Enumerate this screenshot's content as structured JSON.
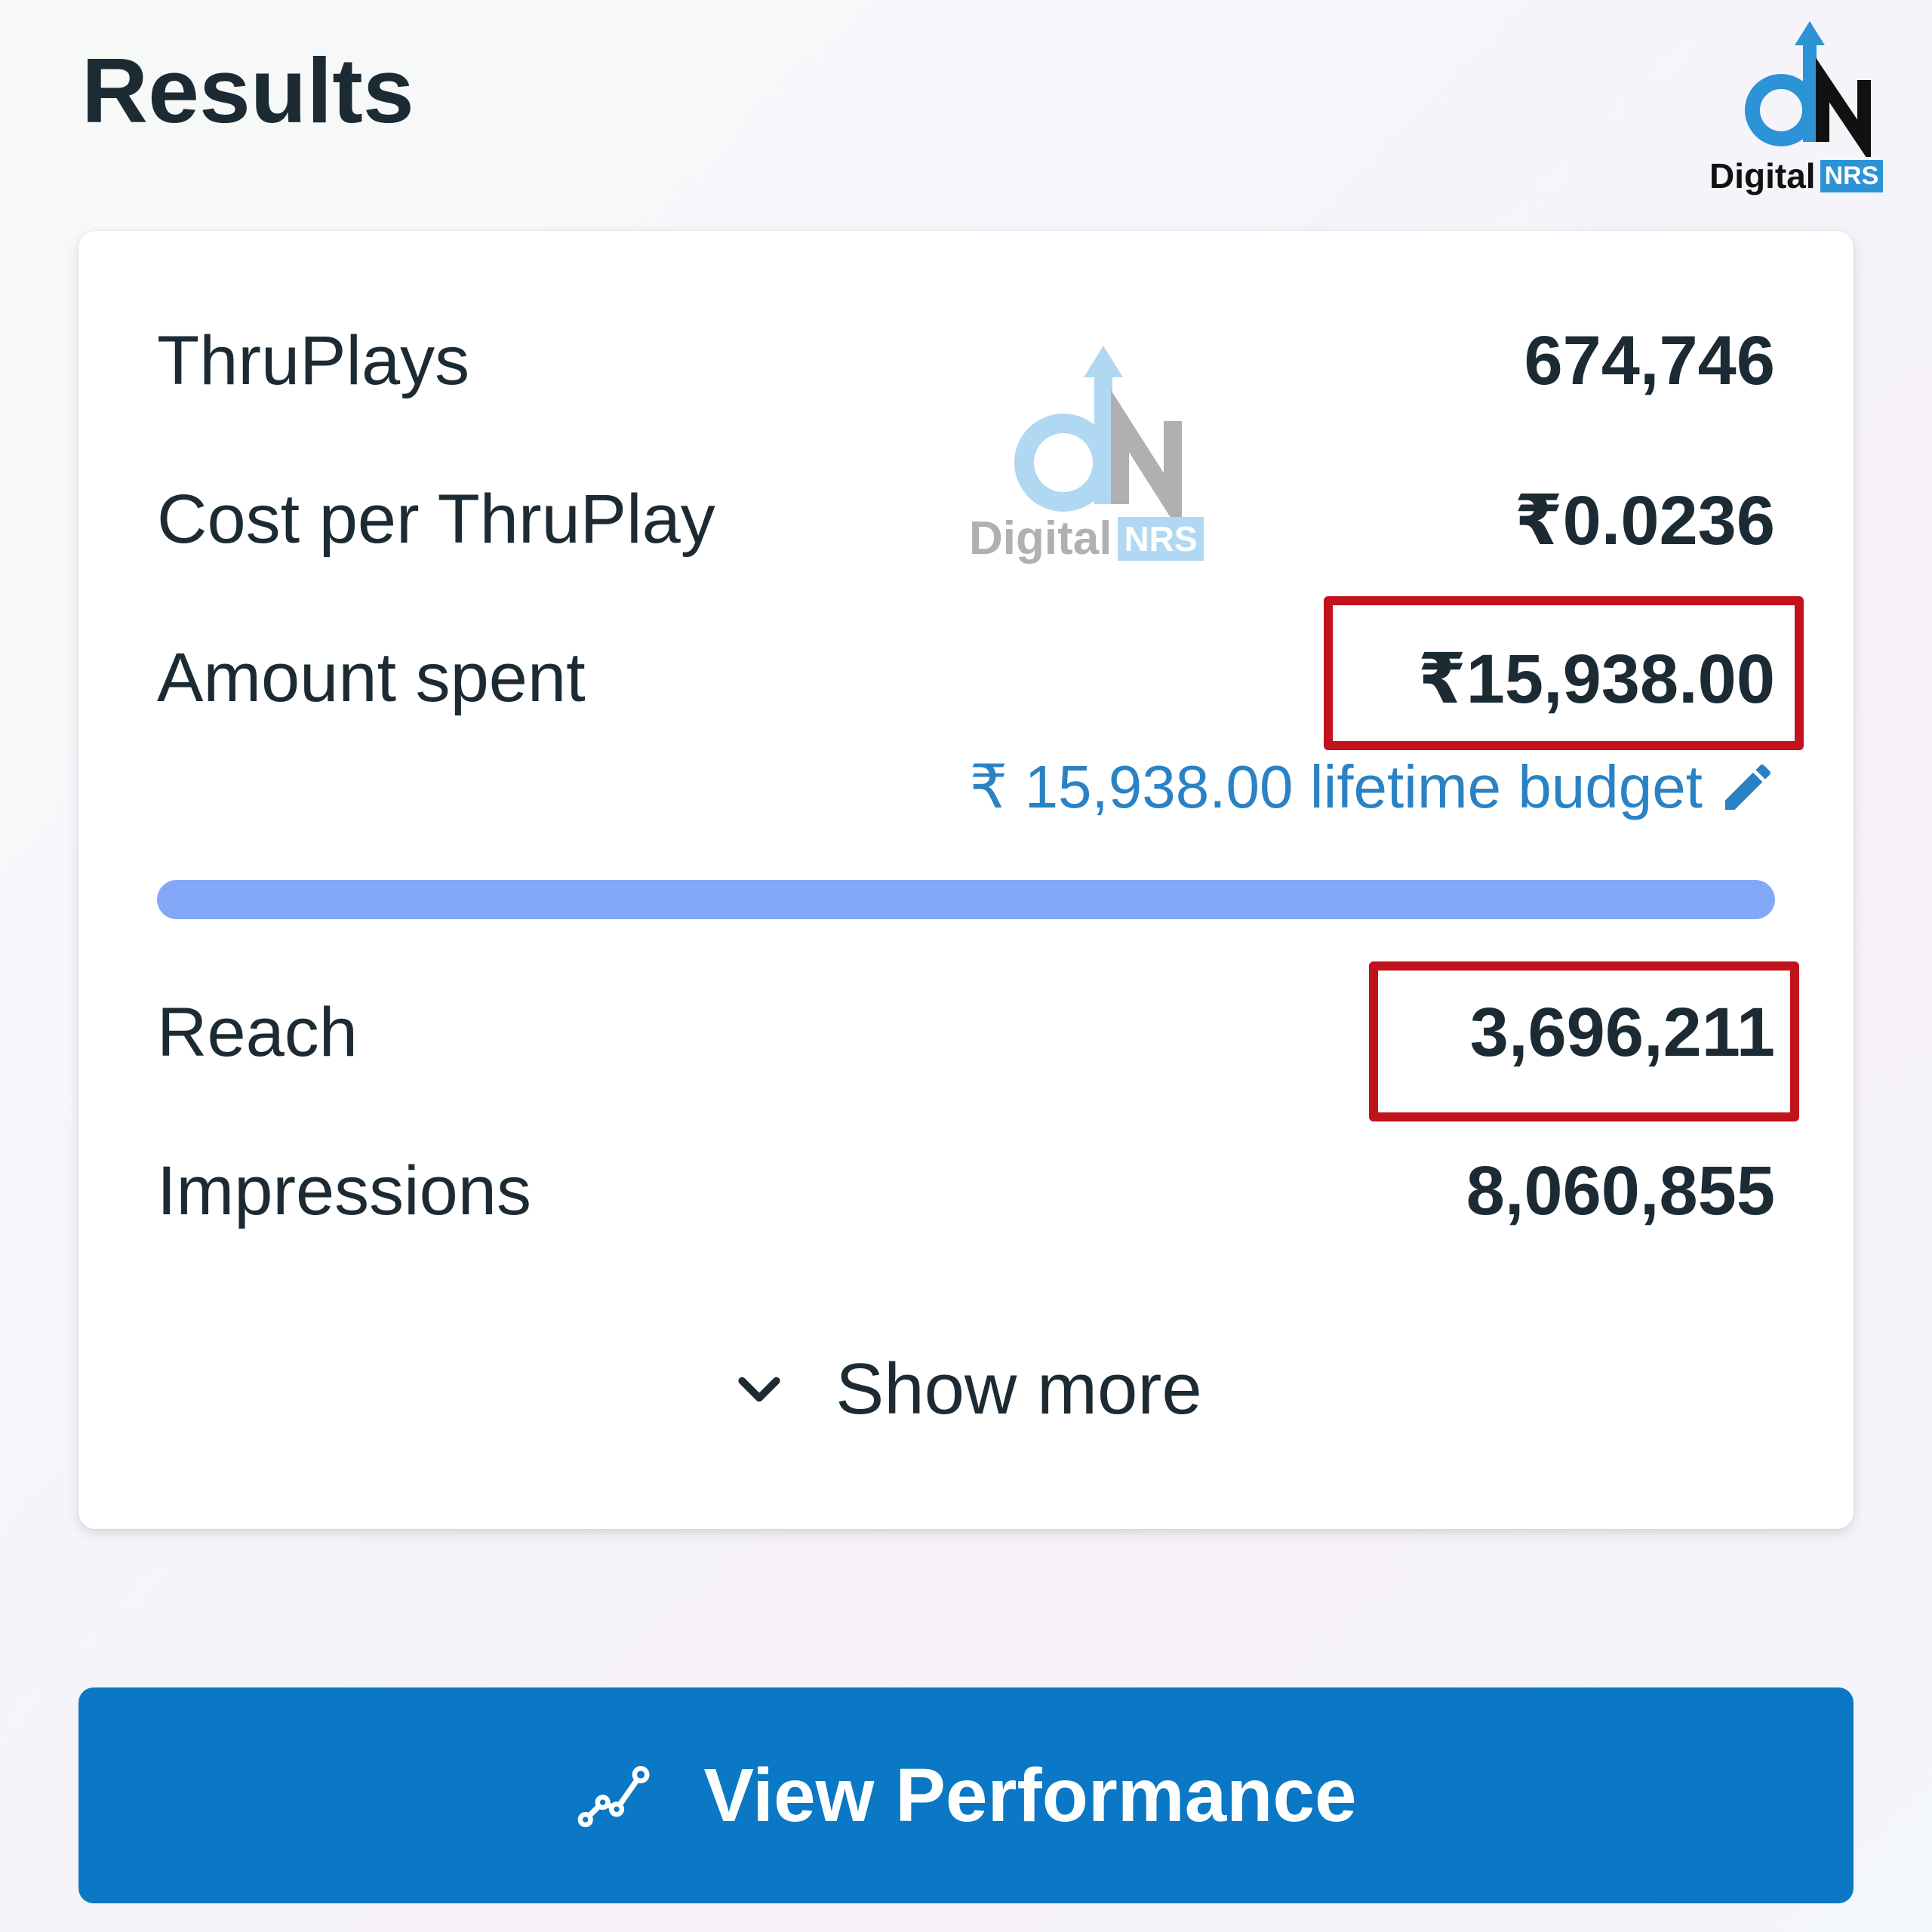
{
  "header": {
    "title": "Results"
  },
  "logo": {
    "brand": "Digital",
    "brand_tag": "NRS"
  },
  "results": {
    "rows": [
      {
        "label": "ThruPlays",
        "value": "674,746"
      },
      {
        "label": "Cost per ThruPlay",
        "value": "₹0.0236"
      },
      {
        "label": "Amount spent",
        "value": "₹15,938.00"
      }
    ],
    "budget_text": "₹ 15,938.00 lifetime budget",
    "budget_progress_percent": 100,
    "rows_after": [
      {
        "label": "Reach",
        "value": "3,696,211"
      },
      {
        "label": "Impressions",
        "value": "8,060,855"
      }
    ],
    "show_more_label": "Show more"
  },
  "actions": {
    "view_performance_label": "View Performance"
  },
  "colors": {
    "primary_button": "#0a78c4",
    "link": "#2a82c4",
    "progress_fill": "#83a8f8",
    "highlight_box": "#c2121c",
    "text": "#1c2b33"
  },
  "icons": {
    "edit": "pencil-icon",
    "expand": "chevron-down-icon",
    "performance": "chart-line-icon"
  }
}
